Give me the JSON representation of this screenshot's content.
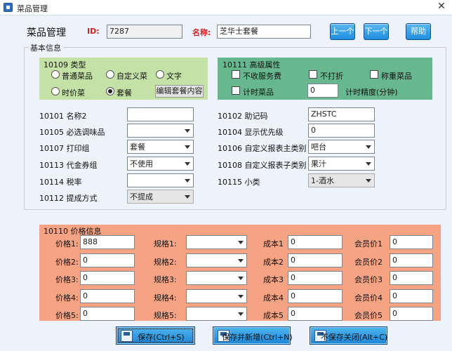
{
  "window": {
    "title": "菜品管理",
    "close_glyph": "✕",
    "icon": "app-icon"
  },
  "header": {
    "title": "菜品管理",
    "id_label": "ID:",
    "id_value": "7287",
    "name_label": "名称:",
    "name_value": "芝华士套餐",
    "prev_button": "上一个",
    "next_button": "下一个",
    "help_button": "帮助"
  },
  "basic_info": {
    "legend": "基本信息"
  },
  "type_panel": {
    "title": "10109 类型",
    "options": [
      {
        "label": "普通菜品",
        "selected": false
      },
      {
        "label": "自定义菜",
        "selected": false
      },
      {
        "label": "文字",
        "selected": false
      },
      {
        "label": "时价菜",
        "selected": false
      },
      {
        "label": "套餐",
        "selected": true
      }
    ],
    "edit_button": "编辑套餐内容"
  },
  "advanced_panel": {
    "title": "10111 高级属性",
    "checks": [
      {
        "label": "不收服务费",
        "checked": false
      },
      {
        "label": "不打折",
        "checked": false
      },
      {
        "label": "称重菜品",
        "checked": false
      },
      {
        "label": "计时菜品",
        "checked": false
      }
    ],
    "timing_value": "0",
    "timing_label": "计时精度(分钟)"
  },
  "fields_left": [
    {
      "label": "10101 名称2",
      "kind": "text",
      "value": ""
    },
    {
      "label": "10105 必选调味品",
      "kind": "combo",
      "value": ""
    },
    {
      "label": "10107 打印组",
      "kind": "combo",
      "value": "套餐"
    },
    {
      "label": "10113 代金券组",
      "kind": "combo",
      "value": "不使用"
    },
    {
      "label": "10114 税率",
      "kind": "combo",
      "value": ""
    },
    {
      "label": "10112 提成方式",
      "kind": "combo-disabled",
      "value": "不提成"
    }
  ],
  "fields_right": [
    {
      "label": "10102 助记码",
      "kind": "text",
      "value": "ZHSTC"
    },
    {
      "label": "10104 显示优先级",
      "kind": "text",
      "value": "0"
    },
    {
      "label": "10106 自定义报表主类别",
      "kind": "combo",
      "value": "吧台"
    },
    {
      "label": "10108 自定义报表子类别",
      "kind": "combo",
      "value": "果汁"
    },
    {
      "label": "10115 小类",
      "kind": "combo-disabled",
      "value": "1-酒水"
    }
  ],
  "price_panel": {
    "title": "10110 价格信息",
    "rows": [
      {
        "price_label": "价格1:",
        "price": "888",
        "spec_label": "规格1:",
        "spec": "",
        "cost_label": "成本1",
        "cost": "0",
        "member_label": "会员价1",
        "member": "0"
      },
      {
        "price_label": "价格2:",
        "price": "0",
        "spec_label": "规格2:",
        "spec": "",
        "cost_label": "成本2",
        "cost": "0",
        "member_label": "会员价2",
        "member": "0"
      },
      {
        "price_label": "价格3:",
        "price": "0",
        "spec_label": "规格3:",
        "spec": "",
        "cost_label": "成本3",
        "cost": "0",
        "member_label": "会员价3",
        "member": "0"
      },
      {
        "price_label": "价格4:",
        "price": "0",
        "spec_label": "规格4:",
        "spec": "",
        "cost_label": "成本4",
        "cost": "0",
        "member_label": "会员价4",
        "member": "0"
      },
      {
        "price_label": "价格5:",
        "price": "0",
        "spec_label": "规格5:",
        "spec": "",
        "cost_label": "成本5",
        "cost": "0",
        "member_label": "会员价5",
        "member": "0"
      }
    ]
  },
  "footer": {
    "save_button": "保存(Ctrl+S)",
    "save_new_button": "保存并新增(Ctrl+N)",
    "close_button": "不保存关闭(Alt+C)"
  }
}
